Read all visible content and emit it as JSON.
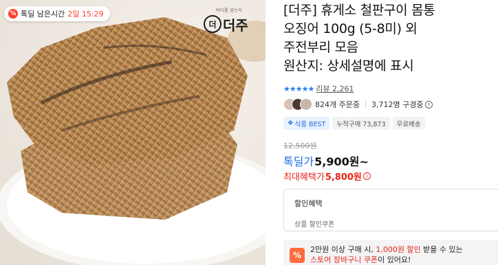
{
  "deal": {
    "label": "톡딜 남은시간",
    "time_remaining": "2일 15:29",
    "icon": "percent-badge-icon"
  },
  "brand": {
    "tagline": "바다를 담는다",
    "name": "더주",
    "logo_mark": "더"
  },
  "product": {
    "title_lines": [
      "[더주] 휴게소 철판구이 몸통",
      "오징어 100g (5-8미) 외",
      "주전부리 모음",
      "원산지: 상세설명에 표시"
    ],
    "rating_stars": "★★★★★",
    "review_text": "리뷰 2,261",
    "ordering": "824개 주문중",
    "watching": "3,712명 구경중",
    "badges": {
      "best": "식품 BEST",
      "cumulative": "누적구매 73,873",
      "shipping": "무료배송"
    }
  },
  "pricing": {
    "original": "12,500원",
    "deal_label": "톡딜가",
    "deal_value": "5,900원~",
    "max_label": "최대혜택가",
    "max_value": "5,800원"
  },
  "coupon": {
    "heading": "할인혜택",
    "sub": "상품 할인쿠폰"
  },
  "promo": {
    "line1_prefix": "2만원 이상 구매 시, ",
    "line1_highlight": "1,000원 할인",
    "line1_suffix": " 받을 수 있는",
    "line2_highlight": "스토어 장바구니 쿠폰",
    "line2_suffix": "이 있어요!"
  },
  "colors": {
    "accent_blue": "#1f6fe5",
    "accent_red": "#e8221b",
    "deal_red": "#ff3d28"
  }
}
